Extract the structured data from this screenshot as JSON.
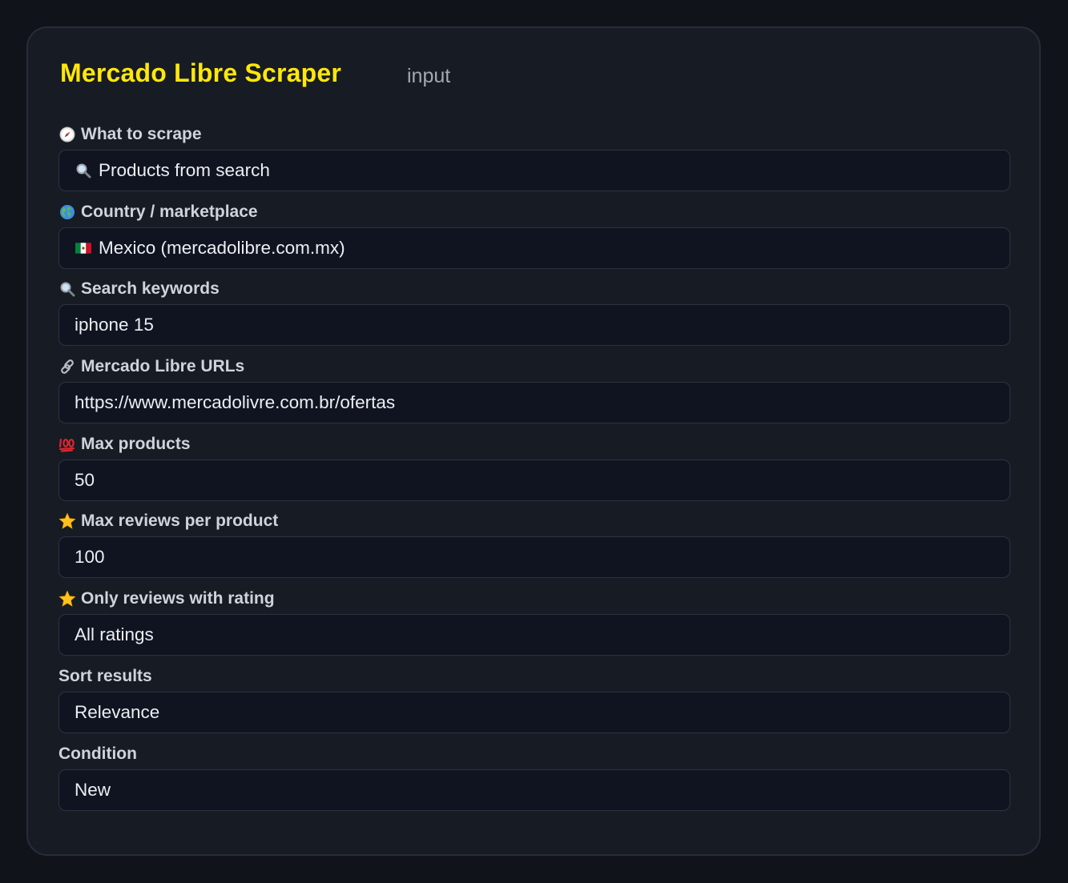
{
  "header": {
    "title": "Mercado Libre Scraper",
    "subtitle": "input"
  },
  "colors": {
    "title": "#ffe70a",
    "panel_bg": "#171b24",
    "field_bg": "#0f1420",
    "page_bg": "#10131a"
  },
  "fields": {
    "what_to_scrape": {
      "icon": "compass-icon",
      "label": "What to scrape",
      "value_icon": "magnifier-icon",
      "value": "Products from search"
    },
    "country": {
      "icon": "globe-icon",
      "label": "Country / marketplace",
      "value_icon": "mexico-flag-icon",
      "value": "Mexico (mercadolibre.com.mx)"
    },
    "search_keywords": {
      "icon": "magnifier-icon",
      "label": "Search keywords",
      "value": "iphone 15"
    },
    "urls": {
      "icon": "link-icon",
      "label": "Mercado Libre URLs",
      "value": "https://www.mercadolivre.com.br/ofertas"
    },
    "max_products": {
      "icon": "hundred-points-icon",
      "label": "Max products",
      "value": "50"
    },
    "max_reviews": {
      "icon": "star-icon",
      "label": "Max reviews per product",
      "value": "100"
    },
    "rating_filter": {
      "icon": "star-icon",
      "label": "Only reviews with rating",
      "value": "All ratings"
    },
    "sort": {
      "label": "Sort results",
      "value": "Relevance"
    },
    "condition": {
      "label": "Condition",
      "value": "New"
    }
  }
}
